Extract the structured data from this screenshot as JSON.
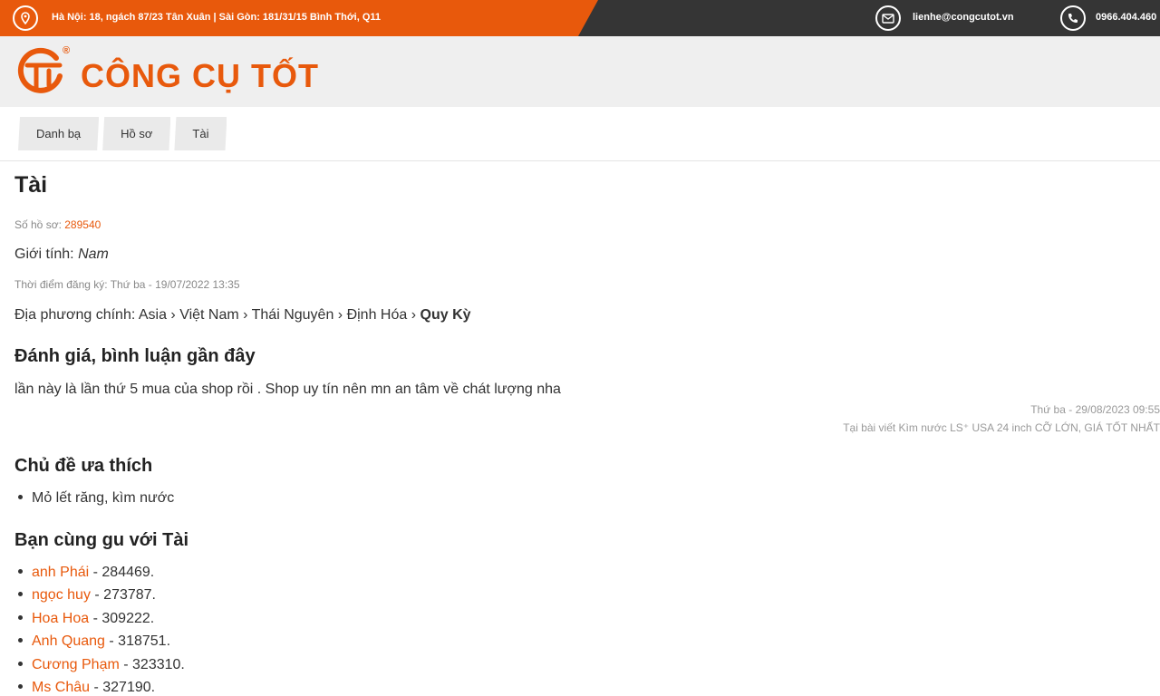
{
  "topbar": {
    "address": "Hà Nội: 18, ngách 87/23 Tân Xuân | Sài Gòn: 181/31/15 Bình Thới, Q11",
    "email": "lienhe@congcutot.vn",
    "phone": "0966.404.460",
    "icons": [
      "map-pin-icon",
      "mail-icon",
      "phone-icon"
    ],
    "colors": {
      "accent": "#e8590c",
      "dark": "#353535"
    }
  },
  "header": {
    "brand": "CÔNG CỤ TỐT",
    "registered": "®"
  },
  "breadcrumb": [
    {
      "label": "Danh bạ"
    },
    {
      "label": "Hồ sơ"
    },
    {
      "label": "Tài"
    }
  ],
  "profile": {
    "name": "Tài",
    "id_label": "Số hồ sơ:",
    "id_value": "289540",
    "gender_label": "Giới tính:",
    "gender_value": "Nam",
    "registered_label": "Thời điểm đăng ký:",
    "registered_value": "Thứ ba - 19/07/2022 13:35",
    "location_label": "Địa phương chính:",
    "location_path": "Asia › Việt Nam › Thái Nguyên › Định Hóa ›",
    "location_last": "Quy Kỳ"
  },
  "reviews": {
    "heading": "Đánh giá, bình luận gần đây",
    "items": [
      {
        "text": "lần này là lần thứ 5 mua của shop rồi . Shop uy tín nên mn an tâm về chát lượng nha",
        "time": "Thứ ba - 29/08/2023 09:55",
        "source": "Tại bài viết Kìm nước LS⁺ USA 24 inch CỠ LỚN, GIÁ TỐT NHẤT"
      }
    ]
  },
  "topics": {
    "heading": "Chủ đề ưa thích",
    "items": [
      "Mỏ lết răng, kìm nước"
    ]
  },
  "friends": {
    "heading": "Bạn cùng gu với Tài",
    "items": [
      {
        "name": "anh Phái",
        "id": "- 284469."
      },
      {
        "name": "ngọc huy",
        "id": "- 273787."
      },
      {
        "name": "Hoa Hoa",
        "id": "- 309222."
      },
      {
        "name": "Anh Quang",
        "id": "- 318751."
      },
      {
        "name": "Cương Phạm",
        "id": "- 323310."
      },
      {
        "name": "Ms Châu",
        "id": "- 327190."
      }
    ]
  }
}
